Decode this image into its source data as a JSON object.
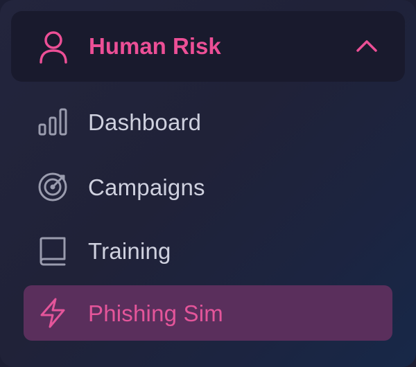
{
  "section": {
    "title": "Human Risk",
    "icon": "user-icon",
    "expanded": true,
    "accent_color": "#ec4f96"
  },
  "items": [
    {
      "label": "Dashboard",
      "icon": "bar-chart-icon",
      "active": false
    },
    {
      "label": "Campaigns",
      "icon": "target-icon",
      "active": false
    },
    {
      "label": "Training",
      "icon": "book-icon",
      "active": false
    },
    {
      "label": "Phishing Sim",
      "icon": "lightning-icon",
      "active": true
    }
  ],
  "colors": {
    "background": "#202238",
    "header_bg": "#191a2d",
    "active_bg": "#5a2f5c",
    "text": "#cfd1df",
    "icon": "#9a9cae"
  }
}
